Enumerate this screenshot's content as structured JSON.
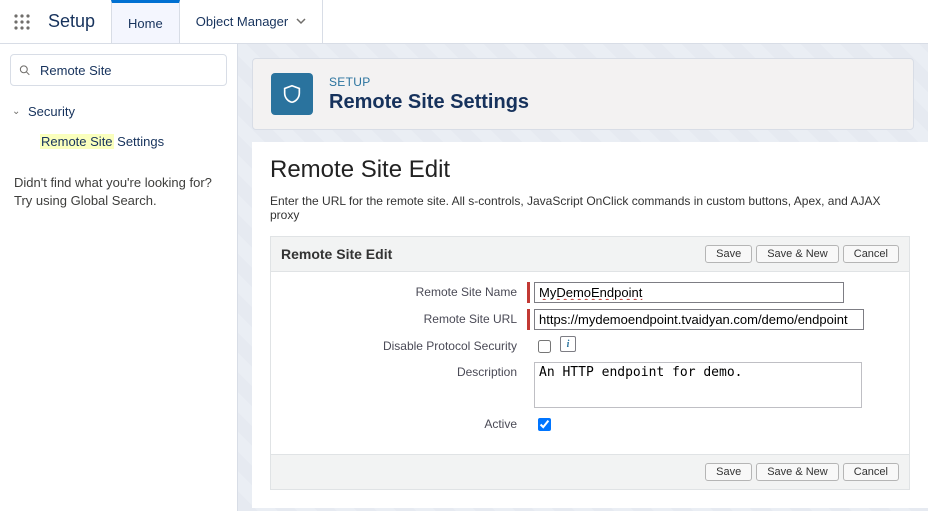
{
  "nav": {
    "app_title": "Setup",
    "tabs": [
      {
        "label": "Home",
        "active": true
      },
      {
        "label": "Object Manager",
        "active": false,
        "has_menu": true
      }
    ]
  },
  "sidebar": {
    "search_value": "Remote Site",
    "tree": {
      "node_label": "Security",
      "child_label_hl": "Remote Site",
      "child_label_rest": " Settings"
    },
    "nofind_line1": "Didn't find what you're looking for?",
    "nofind_line2": "Try using Global Search."
  },
  "header": {
    "eyebrow": "SETUP",
    "title": "Remote Site Settings"
  },
  "classic": {
    "h1": "Remote Site Edit",
    "blurb": "Enter the URL for the remote site. All s-controls, JavaScript OnClick commands in custom buttons, Apex, and AJAX proxy ",
    "panel_title": "Remote Site Edit",
    "buttons": {
      "save": "Save",
      "save_new": "Save & New",
      "cancel": "Cancel"
    },
    "fields": {
      "name_label": "Remote Site Name",
      "name_value": "MyDemoEndpoint",
      "url_label": "Remote Site URL",
      "url_value": "https://mydemoendpoint.tvaidyan.com/demo/endpoint",
      "disable_label": "Disable Protocol Security",
      "desc_label": "Description",
      "desc_value": "An HTTP endpoint for demo.",
      "active_label": "Active"
    }
  }
}
